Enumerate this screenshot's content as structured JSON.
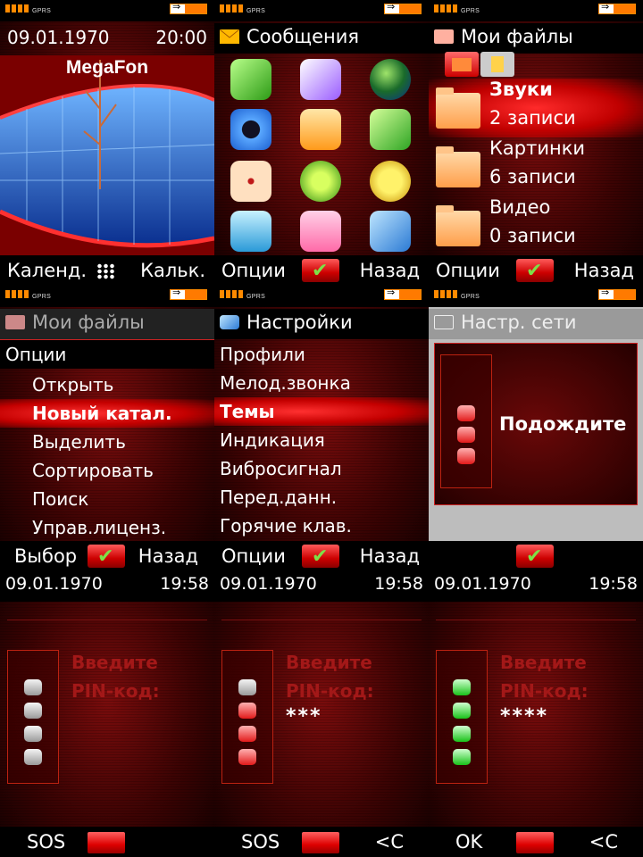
{
  "status": {
    "network": "GPRS"
  },
  "standby": {
    "date": "09.01.1970",
    "time": "20:00",
    "operator": "MegaFon",
    "left_softkey": "Календ.",
    "right_softkey": "Кальк.",
    "menu_icon": "grid-menu-icon"
  },
  "messages_menu": {
    "title": "Сообщения",
    "left_softkey": "Опции",
    "right_softkey": "Назад",
    "icons": [
      "phonebook-icon",
      "media-icon",
      "internet-globe-icon",
      "camera-icon",
      "messaging-envelope-icon",
      "calendar-organizer-icon",
      "games-dice-icon",
      "media-player-icon",
      "alarm-clock-icon",
      "entertainment-box-icon",
      "file-manager-folder-icon",
      "settings-wrench-icon"
    ],
    "accent": "#ff8a00"
  },
  "my_files": {
    "title": "Мои файлы",
    "items": [
      {
        "name": "Звуки",
        "count": "2 записи"
      },
      {
        "name": "Картинки",
        "count": "6 записи"
      },
      {
        "name": "Видео",
        "count": "0 записи"
      }
    ],
    "left_softkey": "Опции",
    "right_softkey": "Назад"
  },
  "options_menu": {
    "title": "Мои файлы",
    "heading": "Опции",
    "items": [
      "Открыть",
      "Новый катал.",
      "Выделить",
      "Сортировать",
      "Поиск",
      "Управ.лиценз."
    ],
    "selected_index": 1,
    "left_softkey": "Выбор",
    "right_softkey": "Назад"
  },
  "settings_menu": {
    "title": "Настройки",
    "items": [
      "Профили",
      "Мелод.звонка",
      "Темы",
      "Индикация",
      "Вибросигнал",
      "Перед.данн.",
      "Горячие клав."
    ],
    "selected_index": 2,
    "left_softkey": "Опции",
    "right_softkey": "Назад"
  },
  "network_settings": {
    "title": "Настр. сети",
    "message": "Подождите"
  },
  "pin_screens": [
    {
      "date": "09.01.1970",
      "time": "19:58",
      "label1": "Введите",
      "label2": "PIN-код:",
      "entered": "",
      "left_softkey": "SOS",
      "right_softkey": ""
    },
    {
      "date": "09.01.1970",
      "time": "19:58",
      "label1": "Введите",
      "label2": "PIN-код:",
      "entered": "***",
      "left_softkey": "SOS",
      "right_softkey": "<C"
    },
    {
      "date": "09.01.1970",
      "time": "19:58",
      "label1": "Введите",
      "label2": "PIN-код:",
      "entered": "****",
      "left_softkey": "OK",
      "right_softkey": "<C"
    }
  ],
  "colors": {
    "selection": "#d00000",
    "pin_label": "#a31818",
    "led_green": "#19c219"
  }
}
